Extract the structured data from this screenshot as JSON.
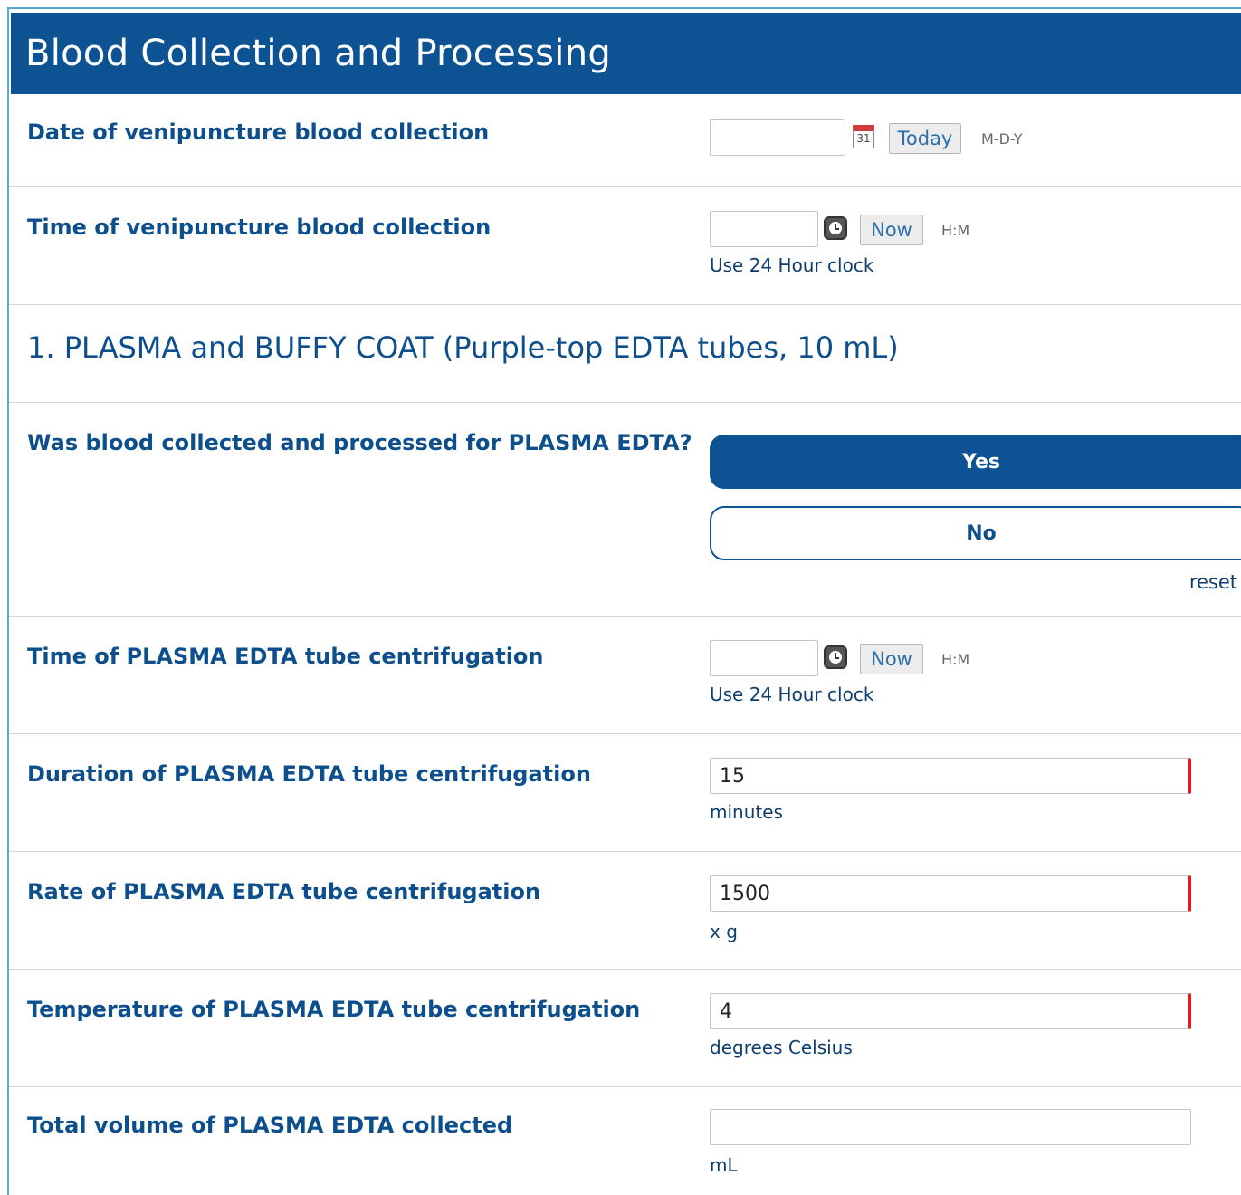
{
  "header": {
    "title": "Blood Collection and Processing"
  },
  "rows": {
    "date_collection": {
      "label": "Date of venipuncture blood collection",
      "value": "",
      "button": "Today",
      "format": "M-D-Y",
      "calendar_text": "31"
    },
    "time_collection": {
      "label": "Time of venipuncture blood collection",
      "value": "",
      "button": "Now",
      "format": "H:M",
      "note": "Use 24 Hour clock"
    },
    "section1": {
      "title": "1. PLASMA and BUFFY COAT (Purple-top EDTA tubes, 10 mL)"
    },
    "plasma_collected": {
      "label": "Was blood collected and processed for PLASMA EDTA?",
      "options": [
        "Yes",
        "No"
      ],
      "selected": "Yes",
      "reset": "reset"
    },
    "time_centrifugation": {
      "label": "Time of PLASMA EDTA tube centrifugation",
      "value": "",
      "button": "Now",
      "format": "H:M",
      "note": "Use 24 Hour clock"
    },
    "duration": {
      "label": "Duration of PLASMA EDTA tube centrifugation",
      "value": "15",
      "unit": "minutes"
    },
    "rate": {
      "label": "Rate of PLASMA EDTA tube centrifugation",
      "value": "1500",
      "unit": "x g"
    },
    "temperature": {
      "label": "Temperature of PLASMA EDTA tube centrifugation",
      "value": "4",
      "unit": "degrees Celsius"
    },
    "volume": {
      "label": "Total volume of PLASMA EDTA collected",
      "value": "",
      "unit": "mL"
    }
  },
  "colors": {
    "header_bg": "#0d5394",
    "label": "#0d4f8c",
    "required_marker": "#e01b1b",
    "frame_border": "#5aa9d6"
  },
  "icons": {
    "calendar": "calendar-icon",
    "clock": "clock-icon"
  }
}
